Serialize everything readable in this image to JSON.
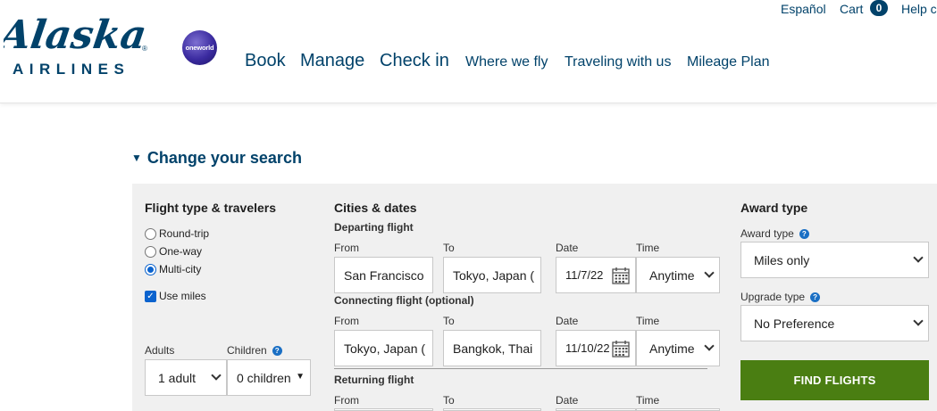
{
  "brand": {
    "name": "Alaska",
    "sub": "AIRLINES",
    "reg": "®",
    "alliance": "oneworld"
  },
  "utility": {
    "espanol": "Español",
    "cart": "Cart",
    "cart_count": "0",
    "help": "Help c"
  },
  "nav": [
    "Book",
    "Manage",
    "Check in",
    "Where we fly",
    "Traveling with us",
    "Mileage Plan"
  ],
  "change_search": {
    "caret": "▼",
    "label": "Change your search"
  },
  "flight_type": {
    "heading": "Flight type & travelers",
    "options": [
      "Round-trip",
      "One-way",
      "Multi-city"
    ],
    "selected": "Multi-city",
    "use_miles": "Use miles",
    "adults_label": "Adults",
    "children_label": "Children",
    "adults_value": "1 adult",
    "children_value": "0 children"
  },
  "cities": {
    "heading": "Cities & dates",
    "departing": {
      "title": "Departing flight",
      "from_label": "From",
      "to_label": "To",
      "date_label": "Date",
      "time_label": "Time",
      "from": "San Francisco",
      "to": "Tokyo, Japan (",
      "date": "11/7/22",
      "time": "Anytime"
    },
    "connecting": {
      "title": "Connecting flight (optional)",
      "from_label": "From",
      "to_label": "To",
      "date_label": "Date",
      "time_label": "Time",
      "from": "Tokyo, Japan (",
      "to": "Bangkok, Thai",
      "date": "11/10/22",
      "time": "Anytime"
    },
    "returning": {
      "title": "Returning flight",
      "from_label": "From",
      "to_label": "To",
      "date_label": "Date",
      "time_label": "Time"
    }
  },
  "award": {
    "heading": "Award type",
    "award_label": "Award type",
    "award_value": "Miles only",
    "upgrade_label": "Upgrade type",
    "upgrade_value": "No Preference",
    "help_glyph": "?"
  },
  "find_button": "FIND FLIGHTS",
  "colors": {
    "brand_blue": "#01426a",
    "button_green": "#4a7e12",
    "panel_bg": "#f0f0f0",
    "check_blue": "#0b63ce"
  }
}
